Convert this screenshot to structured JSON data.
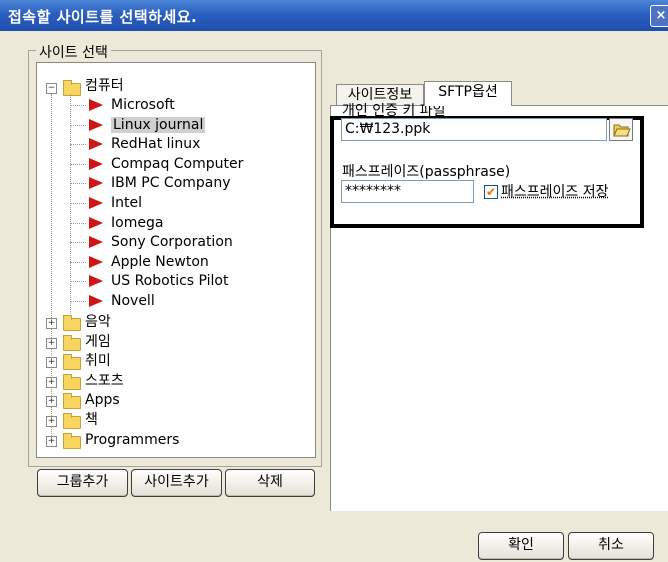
{
  "window": {
    "title": "접속할 사이트를 선택하세요.",
    "close": "×"
  },
  "site_group": {
    "title": "사이트 선택",
    "root": {
      "label": "컴퓨터",
      "expander": "−"
    },
    "children": [
      "Microsoft",
      "Linux journal",
      "RedHat linux",
      "Compaq Computer",
      "IBM PC Company",
      "Intel",
      "Iomega",
      "Sony Corporation",
      "Apple Newton",
      "US Robotics Pilot",
      "Novell"
    ],
    "selected_child": "Linux journal",
    "folders": [
      "음악",
      "게임",
      "취미",
      "스포츠",
      "Apps",
      "책",
      "Programmers"
    ],
    "collapsed_expander": "+"
  },
  "buttons": {
    "add_group": "그룹추가",
    "add_site": "사이트추가",
    "delete": "삭제",
    "ok": "확인",
    "cancel": "취소"
  },
  "tabs": [
    "사이트정보",
    "SFTP옵션"
  ],
  "active_tab": "SFTP옵션",
  "sftp": {
    "key_file_label": "개인 인증 키 파일",
    "key_file_value": "C:₩123.ppk",
    "passphrase_label": "패스프레이즈(passphrase)",
    "passphrase_value": "********",
    "save_passphrase_label": "패스프레이즈 저장",
    "save_passphrase_checked": true,
    "check_mark": "✔"
  },
  "colors": {
    "titlebar": "#2a5fc0",
    "window_bg": "#ece9d8",
    "arrow": "#d01515",
    "folder": "#f7d55e"
  },
  "icons": [
    "close-icon",
    "folder-icon",
    "red-arrow-icon",
    "expand-icon",
    "collapse-icon",
    "open-folder-icon",
    "checkbox-icon"
  ]
}
